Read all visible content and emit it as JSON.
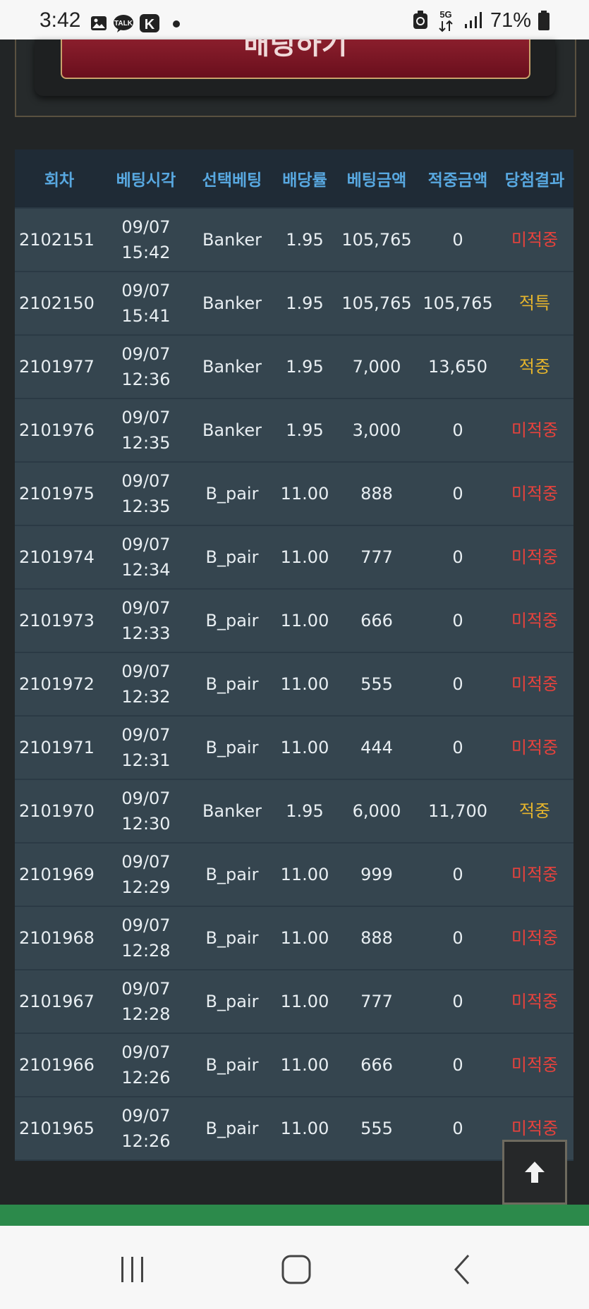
{
  "status_bar": {
    "time": "3:42",
    "icons_left": [
      "gallery-icon",
      "kakaotalk-icon",
      "kakao-k-icon",
      "dot-icon"
    ],
    "icons_right": [
      "recycle-icon",
      "5g-icon",
      "signal-icon",
      "battery-icon"
    ],
    "network": "5G",
    "battery": "71%"
  },
  "bet_panel": {
    "bet_button_label": "배팅하기"
  },
  "table": {
    "headers": [
      "회차",
      "베팅시각",
      "선택베팅",
      "배당률",
      "베팅금액",
      "적중금액",
      "당첨결과"
    ],
    "rows": [
      {
        "round": "2102151",
        "date": "09/07",
        "time": "15:42",
        "pick": "Banker",
        "odds": "1.95",
        "bet": "105,765",
        "win": "0",
        "result": "미적중",
        "status": "miss"
      },
      {
        "round": "2102150",
        "date": "09/07",
        "time": "15:41",
        "pick": "Banker",
        "odds": "1.95",
        "bet": "105,765",
        "win": "105,765",
        "result": "적특",
        "status": "hit"
      },
      {
        "round": "2101977",
        "date": "09/07",
        "time": "12:36",
        "pick": "Banker",
        "odds": "1.95",
        "bet": "7,000",
        "win": "13,650",
        "result": "적중",
        "status": "hit"
      },
      {
        "round": "2101976",
        "date": "09/07",
        "time": "12:35",
        "pick": "Banker",
        "odds": "1.95",
        "bet": "3,000",
        "win": "0",
        "result": "미적중",
        "status": "miss"
      },
      {
        "round": "2101975",
        "date": "09/07",
        "time": "12:35",
        "pick": "B_pair",
        "odds": "11.00",
        "bet": "888",
        "win": "0",
        "result": "미적중",
        "status": "miss"
      },
      {
        "round": "2101974",
        "date": "09/07",
        "time": "12:34",
        "pick": "B_pair",
        "odds": "11.00",
        "bet": "777",
        "win": "0",
        "result": "미적중",
        "status": "miss"
      },
      {
        "round": "2101973",
        "date": "09/07",
        "time": "12:33",
        "pick": "B_pair",
        "odds": "11.00",
        "bet": "666",
        "win": "0",
        "result": "미적중",
        "status": "miss"
      },
      {
        "round": "2101972",
        "date": "09/07",
        "time": "12:32",
        "pick": "B_pair",
        "odds": "11.00",
        "bet": "555",
        "win": "0",
        "result": "미적중",
        "status": "miss"
      },
      {
        "round": "2101971",
        "date": "09/07",
        "time": "12:31",
        "pick": "B_pair",
        "odds": "11.00",
        "bet": "444",
        "win": "0",
        "result": "미적중",
        "status": "miss"
      },
      {
        "round": "2101970",
        "date": "09/07",
        "time": "12:30",
        "pick": "Banker",
        "odds": "1.95",
        "bet": "6,000",
        "win": "11,700",
        "result": "적중",
        "status": "hit"
      },
      {
        "round": "2101969",
        "date": "09/07",
        "time": "12:29",
        "pick": "B_pair",
        "odds": "11.00",
        "bet": "999",
        "win": "0",
        "result": "미적중",
        "status": "miss"
      },
      {
        "round": "2101968",
        "date": "09/07",
        "time": "12:28",
        "pick": "B_pair",
        "odds": "11.00",
        "bet": "888",
        "win": "0",
        "result": "미적중",
        "status": "miss"
      },
      {
        "round": "2101967",
        "date": "09/07",
        "time": "12:28",
        "pick": "B_pair",
        "odds": "11.00",
        "bet": "777",
        "win": "0",
        "result": "미적중",
        "status": "miss"
      },
      {
        "round": "2101966",
        "date": "09/07",
        "time": "12:26",
        "pick": "B_pair",
        "odds": "11.00",
        "bet": "666",
        "win": "0",
        "result": "미적중",
        "status": "miss"
      },
      {
        "round": "2101965",
        "date": "09/07",
        "time": "12:26",
        "pick": "B_pair",
        "odds": "11.00",
        "bet": "555",
        "win": "0",
        "result": "미적중",
        "status": "miss"
      }
    ]
  },
  "scroll_top": {
    "icon": "arrow-up-icon"
  },
  "colors": {
    "miss": "#e8423c",
    "hit": "#e6b52c",
    "header_text": "#58a8e0"
  },
  "nav_bar": {
    "icons": [
      "recent-apps-icon",
      "home-icon",
      "back-icon"
    ]
  }
}
